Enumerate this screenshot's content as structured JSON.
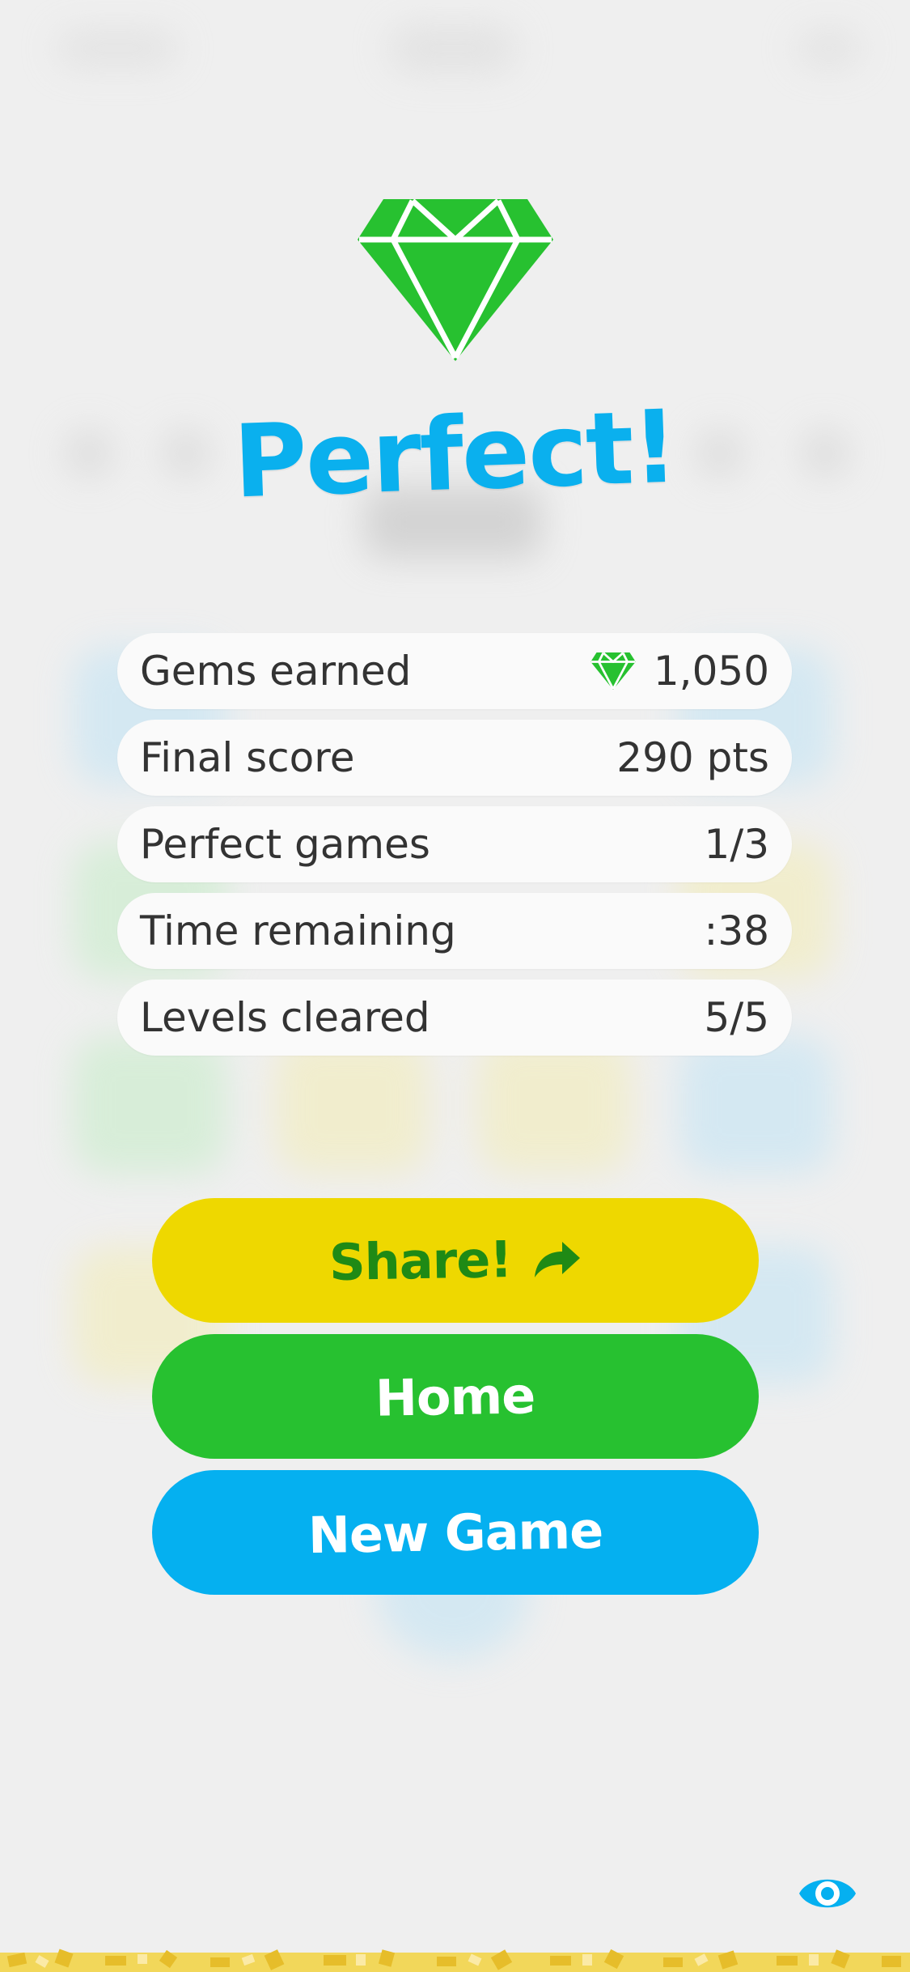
{
  "result": {
    "title": "Perfect!"
  },
  "stats": [
    {
      "label": "Gems earned",
      "value": "1,050",
      "icon": "gem-icon"
    },
    {
      "label": "Final score",
      "value": "290 pts"
    },
    {
      "label": "Perfect games",
      "value": "1/3"
    },
    {
      "label": "Time remaining",
      "value": ":38"
    },
    {
      "label": "Levels cleared",
      "value": "5/5"
    }
  ],
  "actions": {
    "share_label": "Share!",
    "home_label": "Home",
    "new_game_label": "New Game"
  },
  "icons": {
    "hero": "gem-icon",
    "share": "share-arrow-icon",
    "eye": "eye-icon"
  },
  "colors": {
    "title": "#0ab0ee",
    "gem": "#27c130",
    "share": "#eed800",
    "home": "#27c130",
    "new_game": "#05b0f0",
    "background": "#efefef"
  }
}
